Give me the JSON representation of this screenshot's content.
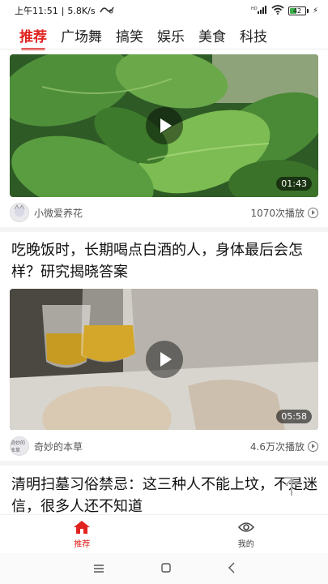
{
  "status": {
    "time": "上午11:51",
    "speed": "5.8K/s",
    "network": "HD",
    "battery": "42"
  },
  "tabs": [
    "推荐",
    "广场舞",
    "搞笑",
    "娱乐",
    "美食",
    "科技"
  ],
  "feed": [
    {
      "title": "",
      "duration": "01:43",
      "author": "小微爱养花",
      "plays": "1070次播放"
    },
    {
      "title": "吃晚饭时，长期喝点白酒的人，身体最后会怎样？研究揭晓答案",
      "duration": "05:58",
      "author": "奇妙的本草",
      "avatar_text": "奇妙的本草",
      "plays": "4.6万次播放"
    },
    {
      "title": "清明扫墓习俗禁忌：这三种人不能上坟，不是迷信，很多人还不知道"
    }
  ],
  "bottom_nav": {
    "home": "推荐",
    "mine": "我的"
  },
  "colors": {
    "accent": "#e0231f"
  },
  "icons": [
    "wifi-icon",
    "signal-icon",
    "battery-icon",
    "play-icon",
    "scroll-top-icon",
    "home-icon",
    "profile-eye-icon",
    "menu-icon",
    "square-icon",
    "back-icon"
  ]
}
